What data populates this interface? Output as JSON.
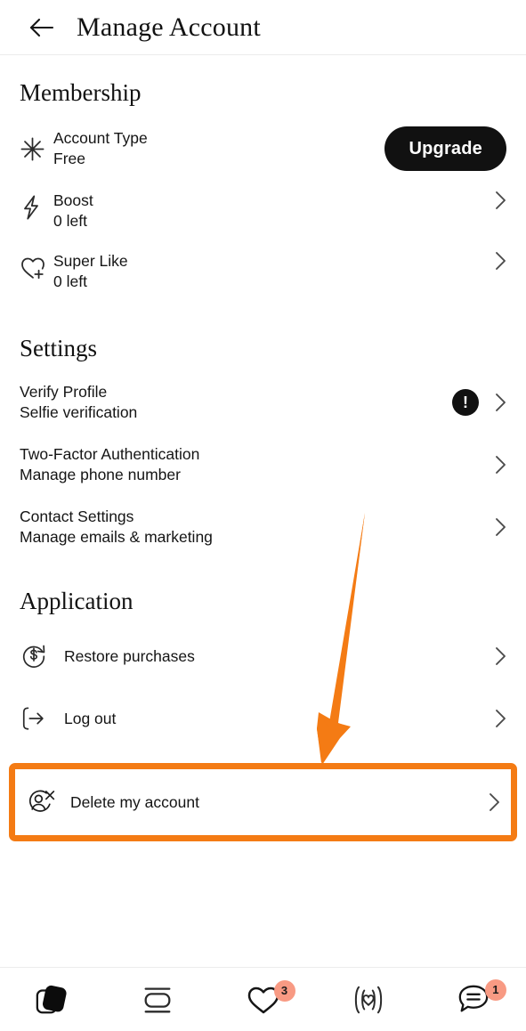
{
  "header": {
    "title": "Manage Account",
    "back_icon": "arrow-left-icon"
  },
  "membership": {
    "section_title": "Membership",
    "items": [
      {
        "icon": "sparkle-asterisk-icon",
        "title": "Account Type",
        "subtitle": "Free",
        "action_label": "Upgrade",
        "has_chevron": false
      },
      {
        "icon": "lightning-bolt-icon",
        "title": "Boost",
        "subtitle": "0 left",
        "has_chevron": true
      },
      {
        "icon": "heart-plus-icon",
        "title": "Super Like",
        "subtitle": "0 left",
        "has_chevron": true
      }
    ]
  },
  "settings": {
    "section_title": "Settings",
    "items": [
      {
        "title": "Verify Profile",
        "subtitle": "Selfie verification",
        "badge": "!",
        "has_badge": true,
        "has_chevron": true
      },
      {
        "title": "Two-Factor Authentication",
        "subtitle": "Manage phone number",
        "has_badge": false,
        "has_chevron": true
      },
      {
        "title": "Contact Settings",
        "subtitle": "Manage emails & marketing",
        "has_badge": false,
        "has_chevron": true
      }
    ]
  },
  "application": {
    "section_title": "Application",
    "items": [
      {
        "icon": "dollar-refresh-icon",
        "title": "Restore purchases",
        "has_chevron": true
      },
      {
        "icon": "logout-arrow-icon",
        "title": "Log out",
        "has_chevron": true
      }
    ],
    "delete": {
      "icon": "person-x-icon",
      "title": "Delete my account",
      "has_chevron": true
    }
  },
  "annotation": {
    "color": "#F47B14",
    "arrow_name": "orange-pointer-arrow",
    "highlight_target": "Delete my account"
  },
  "bottom_nav": {
    "items": [
      {
        "icon": "cards-stack-filled-icon",
        "badge": "",
        "active": true
      },
      {
        "icon": "profile-card-icon",
        "badge": ""
      },
      {
        "icon": "heart-outline-icon",
        "badge": "3"
      },
      {
        "icon": "sonar-heart-icon",
        "badge": ""
      },
      {
        "icon": "chat-bubble-icon",
        "badge": "1"
      }
    ]
  },
  "colors": {
    "accent_orange": "#F47B14",
    "badge_coral": "#F89A83",
    "ink": "#151515"
  }
}
